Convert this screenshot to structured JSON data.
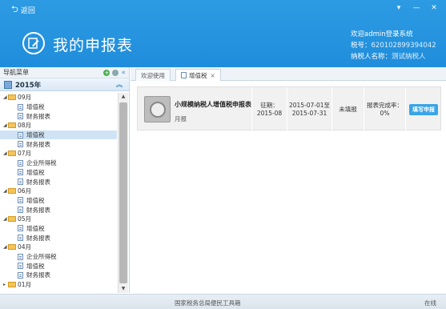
{
  "header": {
    "back_label": "返回",
    "app_title": "我的申报表",
    "window_controls": [
      "▾",
      "—",
      "✕"
    ],
    "welcome": "欢迎admin登录系统",
    "tax_id_label": "税号：",
    "tax_id": "620102899394042",
    "taxpayer_label": "纳税人名称：",
    "taxpayer_name": "测试纳税人"
  },
  "sidebar": {
    "title": "导航菜单",
    "year": "2015年",
    "tree": [
      {
        "month": "09月",
        "items": [
          "增值税",
          "财务报表"
        ]
      },
      {
        "month": "08月",
        "items": [
          "增值税",
          "财务报表"
        ]
      },
      {
        "month": "07月",
        "items": [
          "企业所得税",
          "增值税",
          "财务报表"
        ]
      },
      {
        "month": "06月",
        "items": [
          "增值税",
          "财务报表"
        ]
      },
      {
        "month": "05月",
        "items": [
          "增值税",
          "财务报表"
        ]
      },
      {
        "month": "04月",
        "items": [
          "企业所得税",
          "增值税",
          "财务报表"
        ]
      },
      {
        "month": "01月",
        "items": []
      }
    ],
    "selected": "08月-增值税"
  },
  "tabs": [
    {
      "label": "欢迎使用",
      "active": false
    },
    {
      "label": "增值税",
      "active": true
    }
  ],
  "task": {
    "name": "小规模纳税人增值税申报表",
    "period_type": "月报",
    "deadline_label": "征期：2015-08",
    "date_range": "2015-07-01至2015-07-31",
    "status": "未填报",
    "completion": "报表完成率：0%",
    "action_label": "填写申报"
  },
  "footer": {
    "center": "国家税务总局便民工具箱",
    "status": "在线"
  }
}
